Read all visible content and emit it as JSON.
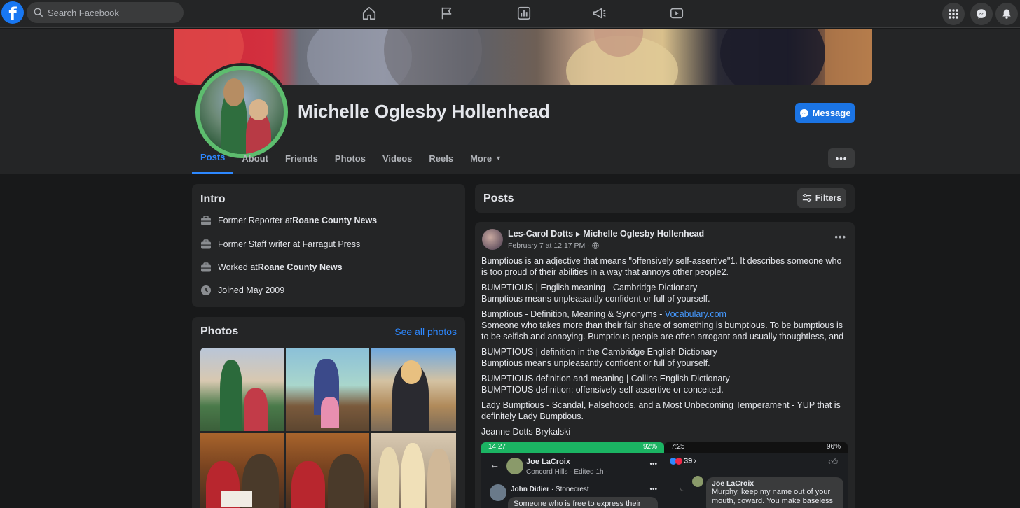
{
  "topbar": {
    "search_placeholder": "Search Facebook",
    "logo": "f"
  },
  "profile": {
    "name": "Michelle Oglesby Hollenhead",
    "message_label": "Message",
    "more_dots": "•••"
  },
  "tabs": {
    "posts": "Posts",
    "about": "About",
    "friends": "Friends",
    "photos": "Photos",
    "videos": "Videos",
    "reels": "Reels",
    "more": "More"
  },
  "intro": {
    "title": "Intro",
    "rows": [
      {
        "prefix": "Former Reporter at ",
        "bold": "Roane County News"
      },
      {
        "prefix": "Former Staff writer at Farragut Press",
        "bold": ""
      },
      {
        "prefix": "Worked at ",
        "bold": "Roane County News"
      },
      {
        "prefix": "Joined May 2009",
        "bold": ""
      }
    ]
  },
  "photos_card": {
    "title": "Photos",
    "see_all": "See all photos"
  },
  "posts_card": {
    "title": "Posts",
    "filters_label": "Filters"
  },
  "post": {
    "author": "Les-Carol Dotts",
    "target": "Michelle Oglesby Hollenhead",
    "time": "February 7 at 12:17 PM ·",
    "more_dots": "•••",
    "paragraphs": {
      "p1": "Bumptious is an adjective that means \"offensively self-assertive\"1. It describes someone who is too proud of their abilities in a way that annoys other people2.",
      "p2a": "BUMPTIOUS | English meaning - Cambridge Dictionary",
      "p2b": "Bumptious means unpleasantly confident or full of yourself.",
      "p3a": "Bumptious - Definition, Meaning & Synonyms - ",
      "p3link": "Vocabulary.com",
      "p3b": "Someone who takes more than their fair share of something is bumptious. To be bumptious is to be selfish and annoying. Bumptious people are often arrogant and usually thoughtless, and",
      "p4a": "BUMPTIOUS | definition in the Cambridge English Dictionary",
      "p4b": "Bumptious means unpleasantly confident or full of yourself.",
      "p5a": "BUMPTIOUS definition and meaning | Collins English Dictionary",
      "p5b": "BUMPTIOUS definition: offensively self-assertive or conceited.",
      "p6": "Lady Bumptious - Scandal, Falsehoods, and a Most Unbecoming Temperament - YUP that is definitely Lady Bumptious.",
      "p7": "Jeanne Dotts Brykalski"
    },
    "screenshot_left": {
      "time": "14:27",
      "battery": "92%",
      "name": "Joe LaCroix",
      "subtitle": "Concord Hills · Edited 1h ·",
      "commenter": "John Didier",
      "commenter_place": "· Stonecrest",
      "comment": "Someone who is free to express their"
    },
    "screenshot_right": {
      "time": "7:25",
      "battery": "96%",
      "reactions": "39",
      "name": "Joe LaCroix",
      "comment": "Murphy, keep my name out of your mouth, coward. You make baseless"
    }
  },
  "colors": {
    "background": "#18191a",
    "surface": "#242526",
    "accent": "#2d88ff",
    "button_blue": "#1b74e4",
    "badge_green": "#5dbd6e"
  }
}
